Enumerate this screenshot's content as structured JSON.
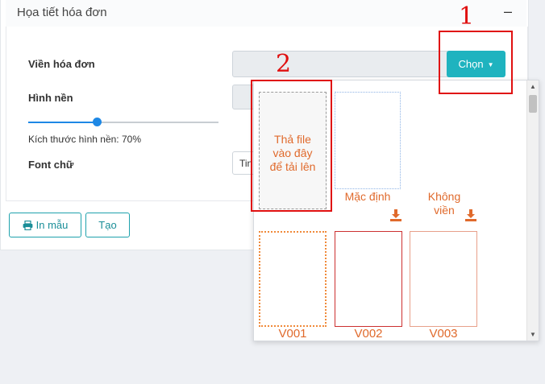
{
  "section": {
    "title": "Họa tiết hóa đơn",
    "collapse_symbol": "–"
  },
  "form": {
    "border_label": "Viền hóa đơn",
    "choose_label": "Chọn",
    "background_label": "Hình nền",
    "background_size_text": "Kích thước hình nền: 70%",
    "background_size_value": 0.36,
    "font_label": "Font chữ",
    "font_value": "Tin"
  },
  "actions": {
    "print_label": "In mẫu",
    "create_label": "Tạo"
  },
  "dropdown": {
    "upload_text": [
      "Thả file",
      "vào đây",
      "để tải lên"
    ],
    "default_label": "Mặc định",
    "no_border_label": [
      "Không",
      "viền"
    ],
    "templates": [
      "V001",
      "V002",
      "V003"
    ]
  },
  "annotations": {
    "one": "1",
    "two": "2"
  },
  "colors": {
    "accent": "#1fb3bf",
    "orange": "#e06a2c",
    "annotation": "#e01010",
    "slider": "#1e88e5"
  }
}
